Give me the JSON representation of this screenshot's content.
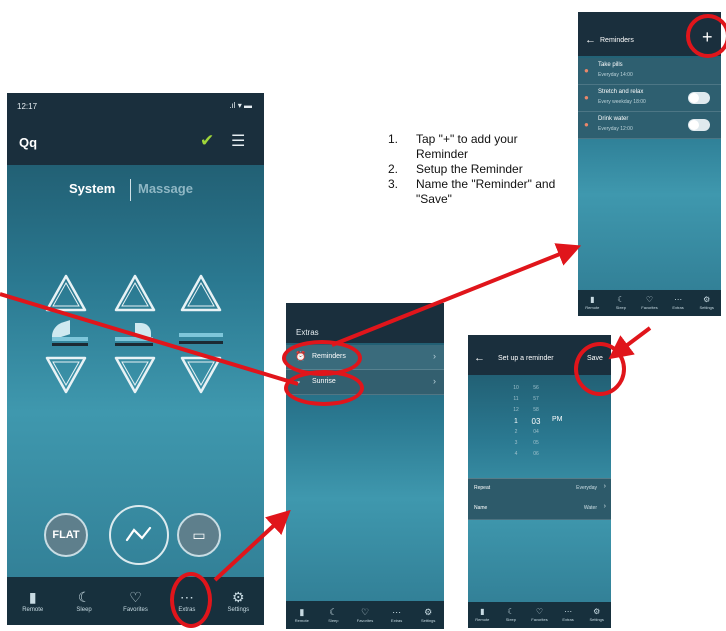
{
  "phone_main": {
    "status_time": "12:17",
    "title": "Qq",
    "seg_system": "System",
    "seg_massage": "Massage",
    "flat_label": "FLAT",
    "tabs": [
      {
        "label": "Remote",
        "icon": "remote-icon"
      },
      {
        "label": "Sleep",
        "icon": "moon-icon"
      },
      {
        "label": "Favorites",
        "icon": "heart-icon"
      },
      {
        "label": "Extras",
        "icon": "more-icon"
      },
      {
        "label": "Settings",
        "icon": "gear-icon"
      }
    ]
  },
  "phone_extras": {
    "title": "Extras",
    "items": [
      "Reminders",
      "Sunrise"
    ]
  },
  "phone_reminders": {
    "title": "Reminders",
    "items": [
      {
        "name": "Take pills",
        "sub": "Everyday 14:00"
      },
      {
        "name": "Stretch and relax",
        "sub": "Every weekday 18:00"
      },
      {
        "name": "Drink water",
        "sub": "Everyday 12:00"
      }
    ],
    "add_label": "+"
  },
  "phone_setup": {
    "title": "Set up a reminder",
    "save": "Save",
    "picker_col1": [
      "10",
      "11",
      "12",
      "1",
      "2",
      "3",
      "4"
    ],
    "picker_col2": [
      "56",
      "57",
      "58",
      "03",
      "04",
      "05",
      "06"
    ],
    "picker_selected": "03",
    "picker_ampm": "PM",
    "row1_label": "Repeat",
    "row1_value": "Everyday",
    "row2_label": "Name",
    "row2_value": "Water"
  },
  "instructions": [
    {
      "num": "1.",
      "text": "Tap \"+\" to add your Reminder"
    },
    {
      "num": "2.",
      "text": "Setup the Reminder"
    },
    {
      "num": "3.",
      "text": "Name the \"Reminder\" and \"Save\""
    }
  ]
}
